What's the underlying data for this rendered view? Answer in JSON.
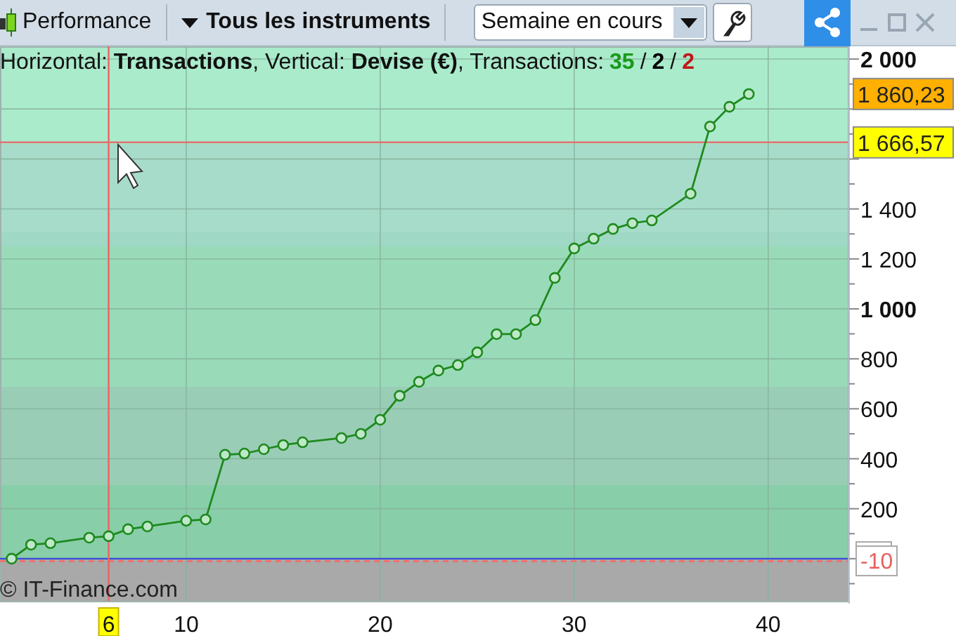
{
  "toolbar": {
    "view": "Performance",
    "instruments": "Tous les instruments",
    "period": "Semaine en cours"
  },
  "info": {
    "text": "Horizontal: **Transactions**, Vertical: **Devise (€)**, Transactions:",
    "separator": "/",
    "counts": [
      {
        "value": "35",
        "color": "#1a9a1a"
      },
      {
        "value": "2",
        "color": "#000000"
      },
      {
        "value": "2",
        "color": "#c01818"
      }
    ]
  },
  "chart": {
    "chart_data": {
      "type": "line",
      "x": [
        1,
        2,
        3,
        5,
        6,
        7,
        8,
        10,
        11,
        12,
        13,
        14,
        15,
        16,
        18,
        19,
        20,
        21,
        22,
        23,
        24,
        25,
        26,
        27,
        28,
        29,
        30,
        31,
        32,
        33,
        34,
        36,
        37,
        38,
        39
      ],
      "series": [
        {
          "color": "#1e8a1e",
          "marker": true,
          "values": [
            0,
            56,
            62,
            84,
            90,
            118,
            129,
            152,
            157,
            416,
            421,
            438,
            455,
            466,
            483,
            500,
            556,
            652,
            708,
            753,
            775,
            826,
            899,
            899,
            955,
            1124,
            1242,
            1281,
            1320,
            1343,
            1354,
            1461,
            1730,
            1809,
            1860
          ]
        }
      ],
      "ref_lines": [
        {
          "axis": "y",
          "value": 0,
          "color": "#3a4ad8"
        },
        {
          "axis": "y",
          "value": -10,
          "color": "#ff6060"
        },
        {
          "axis": "x",
          "value": 6,
          "color": "#f06060"
        },
        {
          "axis": "y",
          "value": 1666.57,
          "color": "#e07070"
        }
      ],
      "xlim": [
        0.4,
        44.1
      ],
      "ylim": [
        -169,
        2051
      ],
      "grid": true,
      "xticks": [
        10,
        20,
        30,
        40
      ],
      "yticks": [
        {
          "value": 200,
          "label": "200"
        },
        {
          "value": 400,
          "label": "400"
        },
        {
          "value": 600,
          "label": "600"
        },
        {
          "value": 800,
          "label": "800"
        },
        {
          "value": 1000,
          "label": "1 000"
        },
        {
          "value": 1200,
          "label": "1 200"
        },
        {
          "value": 1400,
          "label": "1 400"
        },
        {
          "value": 2000,
          "label": "2 000"
        }
      ]
    },
    "price_tags": [
      {
        "value": "1 860,23",
        "color": "#ffb000"
      },
      {
        "value": "1 666,57",
        "color": "#ffff00"
      }
    ],
    "offset_label": "-10",
    "cursor_x_label": "6",
    "watermark": "© IT-Finance.com"
  }
}
